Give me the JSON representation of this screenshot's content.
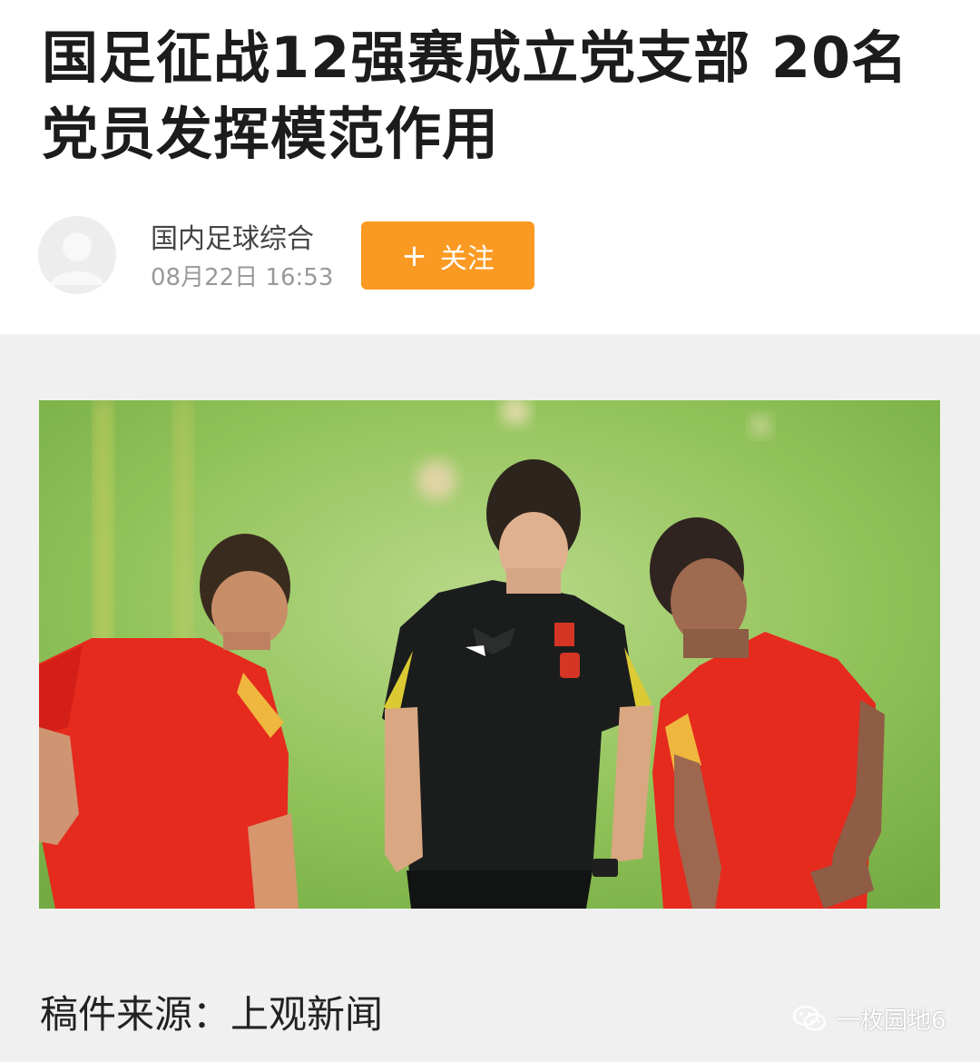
{
  "article": {
    "title": "国足征战12强赛成立党支部 20名党员发挥模范作用"
  },
  "author": {
    "name": "国内足球综合",
    "publish_time": "08月22日  16:53",
    "avatar_icon": "default-user-avatar-icon"
  },
  "follow_button": {
    "plus": "+",
    "label": "关注",
    "color": "#fb9a22"
  },
  "body": {
    "source_line": "稿件来源：上观新闻"
  },
  "watermark": {
    "icon": "wechat-icon",
    "text": "一枚园地6"
  },
  "colors": {
    "pitch": "#8fbf52",
    "red_shirt": "#e52a1e",
    "black_shirt": "#1b1d1c",
    "content_bg": "#f0f0f0"
  }
}
